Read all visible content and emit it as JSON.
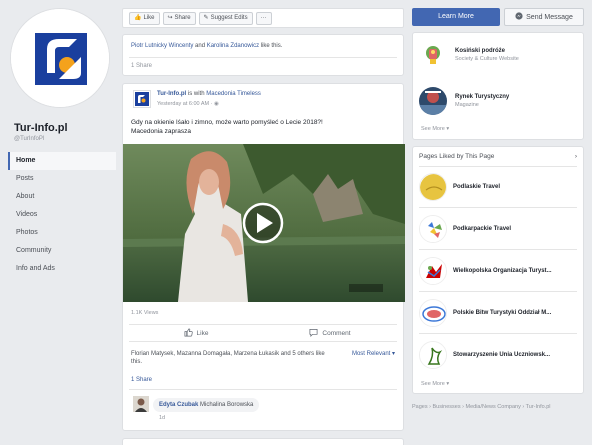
{
  "page": {
    "name": "Tur-Info.pl",
    "handle": "@TurInfoPl"
  },
  "nav": {
    "items": [
      "Home",
      "Posts",
      "About",
      "Videos",
      "Photos",
      "Community",
      "Info and Ads"
    ]
  },
  "actionbar": {
    "like": "Like",
    "share": "Share",
    "suggest": "Suggest Edits",
    "more": "···"
  },
  "cta": {
    "learn_more": "Learn More",
    "send_message": "Send Message"
  },
  "top_post": {
    "likers_a": "Piotr Lutnicky Wincenty",
    "likers_mid": "and",
    "likers_b": "Karolina Zdanowicz",
    "likers_tail": "like this.",
    "shares": "1 Share"
  },
  "post": {
    "author": "Tur-Info.pl",
    "with_text": "is with",
    "with_name": "Macedonia Timeless",
    "time": "Yesterday at 6:00 AM · ",
    "text_line1": "Gdy na okienie lśało i zimno, może warto pomyśleć o Lecie 2018?!",
    "text_line2": "Macedonia zaprasza",
    "views": "1.1K Views",
    "like_action": "Like",
    "comment_action": "Comment",
    "reactors": "Florian Matysek, Mazanna Domagała, Marzena Łukasik and 5 others like this.",
    "most_relevant": "Most Relevant ▾",
    "shares": "1 Share",
    "comment_author": "Edyta Czubak",
    "comment_text": "Michalina Borowska",
    "comment_meta": "1d"
  },
  "related": {
    "items": [
      {
        "title": "Kosiński podróże",
        "sub": "Society & Culture Website"
      },
      {
        "title": "Rynek Turystyczny",
        "sub": "Magazine"
      }
    ],
    "see_more": "See More ▾"
  },
  "liked_pages": {
    "header": "Pages Liked by This Page",
    "chevron": "›",
    "items": [
      "Podlaskie Travel",
      "Podkarpackie Travel",
      "Wielkopolska Organizacja Turyst...",
      "Polskie Bitw Turystyki Oddział M...",
      "Stowarzyszenie Unia Uczniowsk..."
    ],
    "see_more": "See More ▾"
  },
  "breadcrumb": {
    "text": "Pages › Businesses › Media/News Company › Tur-Info.pl"
  },
  "colors": {
    "brand_blue": "#4267b2",
    "link_blue": "#365899",
    "bg": "#e9ebee"
  },
  "icons": {
    "like": "thumbs-up-icon",
    "share": "share-icon",
    "suggest": "pencil-icon",
    "send": "messenger-icon",
    "play": "play-icon",
    "comment": "comment-icon",
    "globe": "globe-icon"
  }
}
